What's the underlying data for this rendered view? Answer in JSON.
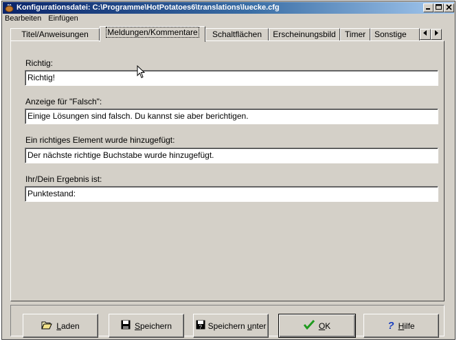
{
  "window": {
    "title": "Konfigurationsdatei: C:\\Programme\\HotPotatoes6\\translations\\luecke.cfg"
  },
  "menu": [
    "Bearbeiten",
    "Einfügen"
  ],
  "tabs": [
    {
      "label": "Titel/Anweisungen",
      "active": false
    },
    {
      "label": "Meldungen/Kommentare",
      "active": true
    },
    {
      "label": "Schaltflächen",
      "active": false
    },
    {
      "label": "Erscheinungsbild",
      "active": false
    },
    {
      "label": "Timer",
      "active": false
    },
    {
      "label": "Sonstige",
      "active": false
    }
  ],
  "fields": [
    {
      "label": "Richtig:",
      "value": "Richtig!"
    },
    {
      "label": "Anzeige für \"Falsch\":",
      "value": "Einige Lösungen sind falsch. Du kannst sie aber berichtigen."
    },
    {
      "label": "Ein richtiges Element wurde hinzugefügt:",
      "value": "Der nächste richtige Buchstabe wurde hinzugefügt."
    },
    {
      "label": "Ihr/Dein Ergebnis ist:",
      "value": "Punktestand:"
    }
  ],
  "buttons": {
    "load": {
      "access": "L",
      "rest": "aden"
    },
    "save": {
      "access": "S",
      "rest": "peichern"
    },
    "save_as": {
      "prefix": "Speichern ",
      "access": "u",
      "rest": "nter"
    },
    "ok": {
      "access": "O",
      "rest": "K"
    },
    "help": {
      "access": "H",
      "rest": "ilfe"
    }
  },
  "colors": {
    "title_gradient_start": "#0a246a",
    "title_gradient_end": "#a6caf0",
    "face": "#d4d0c8",
    "ok_check": "#1e9a1e",
    "help_question": "#1a3fbf"
  }
}
